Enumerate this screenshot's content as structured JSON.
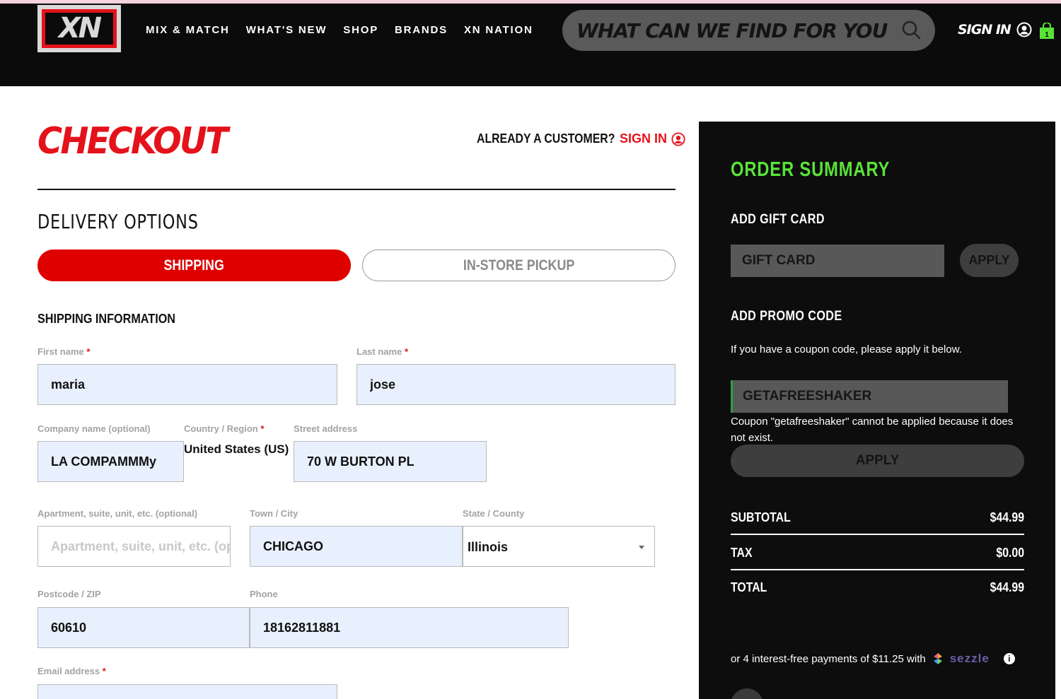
{
  "header": {
    "logo_text": "XN",
    "nav": [
      "MIX & MATCH",
      "WHAT'S NEW",
      "SHOP",
      "BRANDS",
      "XN NATION"
    ],
    "search_placeholder": "WHAT CAN WE FIND FOR YOU?",
    "signin": "SIGN IN",
    "cart_count": "1"
  },
  "checkout": {
    "title": "CHECKOUT",
    "already_customer": "ALREADY A CUSTOMER?",
    "sign_in": "SIGN IN"
  },
  "delivery": {
    "title": "DELIVERY OPTIONS",
    "shipping": "SHIPPING",
    "pickup": "IN-STORE PICKUP"
  },
  "form": {
    "section_title": "SHIPPING INFORMATION",
    "first_name_label": "First name",
    "first_name": "maria",
    "last_name_label": "Last name",
    "last_name": "jose",
    "company_label": "Company name (optional)",
    "company": "LA COMPAMMMy",
    "country_label": "Country / Region",
    "country": "United States (US)",
    "street_label": "Street address",
    "street": "70 W BURTON PL",
    "apt_label": "Apartment, suite, unit, etc. (optional)",
    "apt_placeholder": "Apartment, suite, unit, etc. (optional)",
    "city_label": "Town / City",
    "city": "CHICAGO",
    "state_label": "State / County",
    "state": "Illinois",
    "zip_label": "Postcode / ZIP",
    "zip": "60610",
    "phone_label": "Phone",
    "phone": "18162811881",
    "email_label": "Email address",
    "required_mark": "*"
  },
  "summary": {
    "title": "ORDER SUMMARY",
    "gift_title": "ADD GIFT CARD",
    "gift_placeholder": "GIFT CARD",
    "apply": "APPLY",
    "promo_title": "ADD PROMO CODE",
    "promo_note": "If you have a coupon code, please apply it below.",
    "promo_value": "GETAFREESHAKER",
    "promo_error": "Coupon \"getafreeshaker\" cannot be applied because it does not exist.",
    "apply_large": "APPLY",
    "subtotal_label": "SUBTOTAL",
    "subtotal": "$44.99",
    "tax_label": "TAX",
    "tax": "$0.00",
    "total_label": "TOTAL",
    "total": "$44.99",
    "installments": "or 4 interest-free payments of $11.25 with",
    "sezzle": "sezzle",
    "info": "i"
  },
  "colors": {
    "brand_red": "#e4121b",
    "summary_green": "#59e339",
    "dark": "#0b0b0b"
  }
}
